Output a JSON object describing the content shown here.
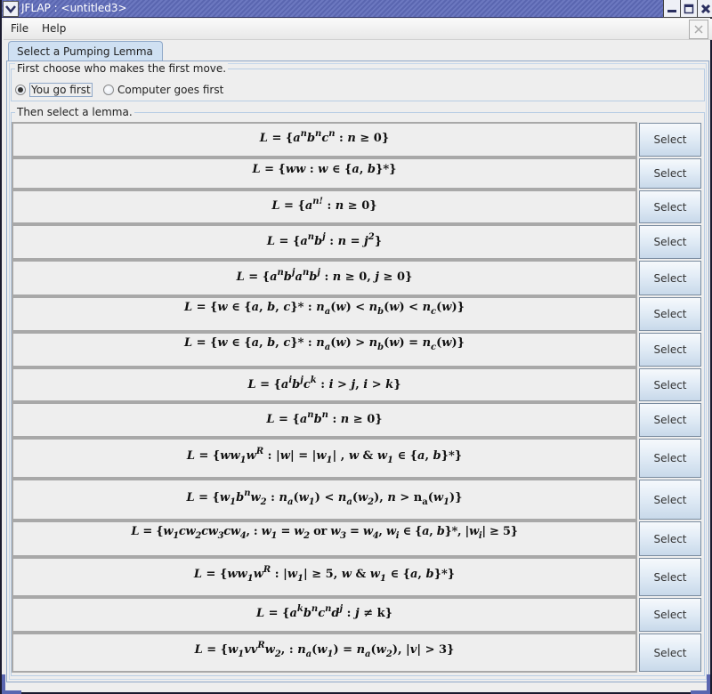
{
  "window": {
    "title": "JFLAP : <untitled3>"
  },
  "menubar": {
    "items": [
      "File",
      "Help"
    ]
  },
  "tab": {
    "label": "Select a Pumping Lemma"
  },
  "first_move": {
    "group_label": "First choose who makes the first move.",
    "options": [
      {
        "label": "You go first",
        "checked": true
      },
      {
        "label": "Computer goes first",
        "checked": false
      }
    ]
  },
  "lemmas": {
    "group_label": "Then select a lemma.",
    "select_label": "Select",
    "items": [
      {
        "text": "L = {a^n b^n c^n : n ≥ 0}"
      },
      {
        "text": "L = {ww : w ∈ {a, b}*}"
      },
      {
        "text": "L = {a^n! : n ≥ 0}"
      },
      {
        "text": "L = {a^n b^j : n = j^2}"
      },
      {
        "text": "L = {a^n b^j a^n b^j : n ≥ 0, j ≥ 0}"
      },
      {
        "text": "L = {w ∈ {a, b, c}* : n_a(w) < n_b(w) < n_c(w)}"
      },
      {
        "text": "L = {w ∈ {a, b, c}* : n_a(w) > n_b(w) = n_c(w)}"
      },
      {
        "text": "L = {a^i b^j c^k : i > j, i > k}"
      },
      {
        "text": "L = {a^n b^n : n ≥ 0}"
      },
      {
        "text": "L = {w w_1 w^R : |w| = |w_1| , w & w_1 ∈ {a, b}*}"
      },
      {
        "text": "L = {w_1 b^n w_2 : n_a(w_1) < n_a(w_2), n > n_a(w_1)}"
      },
      {
        "text": "L = {w_1 c w_2 c w_3 c w_4 : w_1 = w_2 or w_3 = w_4, w_i ∈ {a, b}*, |w_i| ≥ 5}"
      },
      {
        "text": "L = {w w_1 w^R : |w_1| ≥ 5, w & w_1 ∈ {a, b}*}"
      },
      {
        "text": "L = {a^k b^n c^n d^j : j ≠ k}"
      },
      {
        "text": "L = {w_1 v v^R w_2 : n_a(w_1) = n_a(w_2), |v| > 3}"
      }
    ]
  }
}
